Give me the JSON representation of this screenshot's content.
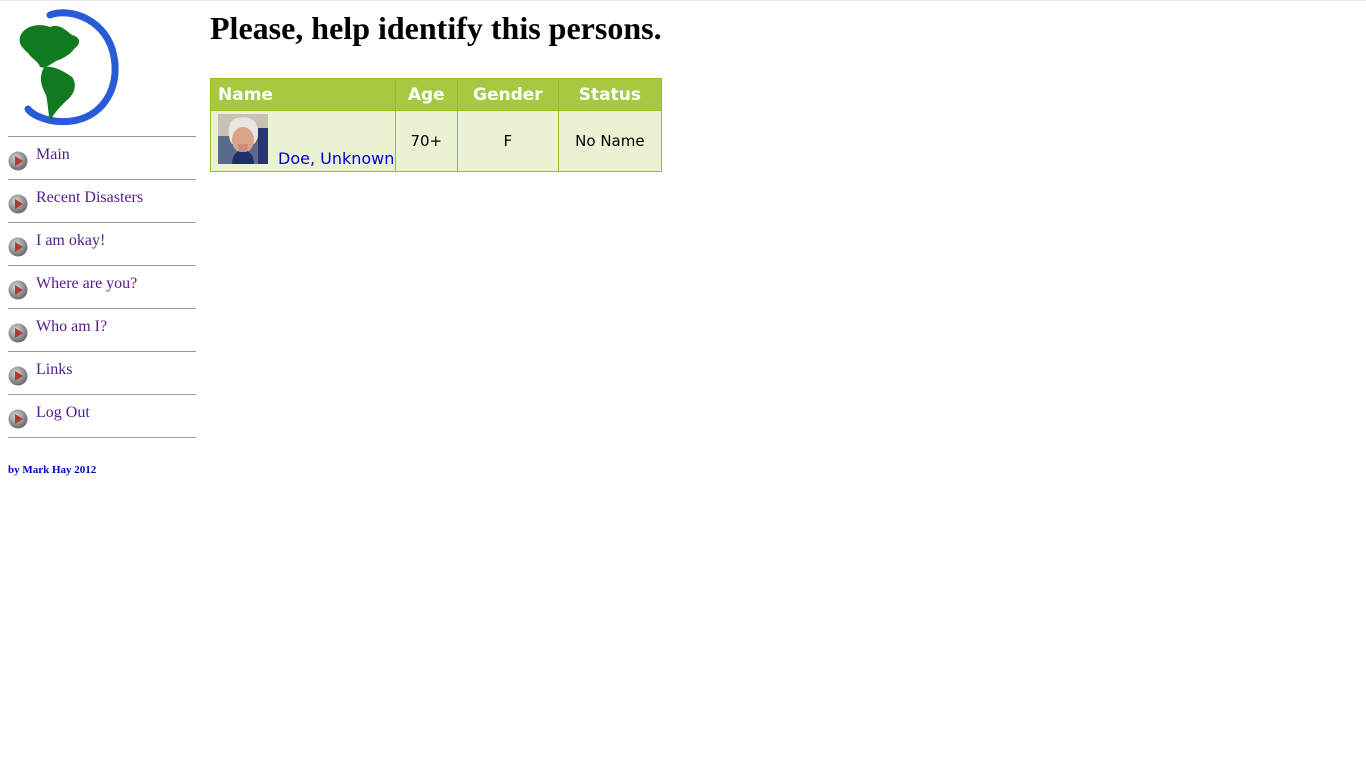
{
  "sidebar": {
    "logo_icon": "globe-americas-logo-icon",
    "nav_bullet_icon": "play-bullet-icon",
    "items": [
      {
        "label": "Main"
      },
      {
        "label": "Recent Disasters"
      },
      {
        "label": "I am okay!"
      },
      {
        "label": "Where are you?"
      },
      {
        "label": "Who am I?"
      },
      {
        "label": "Links"
      },
      {
        "label": "Log Out"
      }
    ],
    "credit": "by Mark Hay 2012"
  },
  "main": {
    "title": "Please, help identify this persons.",
    "table": {
      "headers": {
        "name": "Name",
        "age": "Age",
        "gender": "Gender",
        "status": "Status"
      },
      "rows": [
        {
          "name": "Doe, Unknown",
          "age": "70+",
          "gender": "F",
          "status": "No Name",
          "photo_icon": "person-photo-icon"
        }
      ]
    }
  },
  "colors": {
    "header_bg": "#a7c942",
    "row_bg": "#eaf2d3",
    "border": "#98bf21",
    "link": "#0000cc",
    "nav_text": "#551a8b"
  }
}
